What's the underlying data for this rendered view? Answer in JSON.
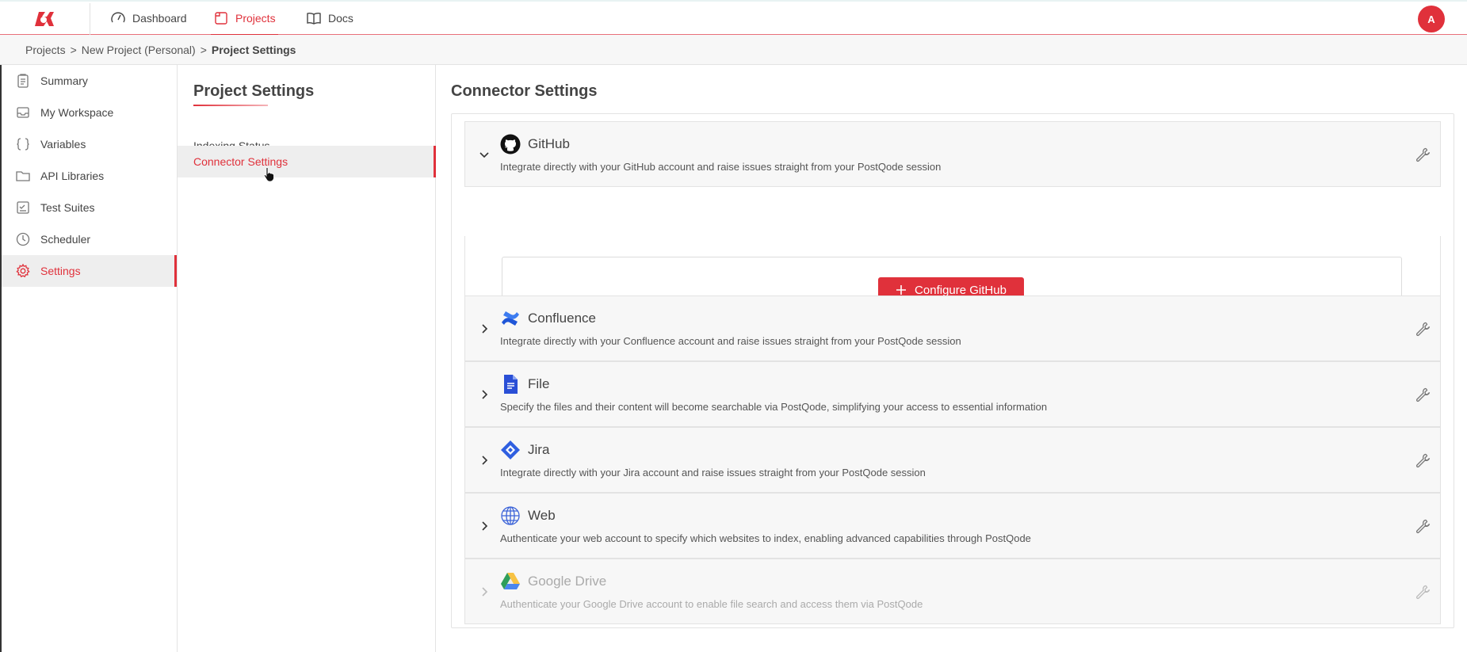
{
  "nav": {
    "tabs": [
      {
        "label": "Dashboard",
        "icon": "gauge-icon"
      },
      {
        "label": "Projects",
        "icon": "folder-icon"
      },
      {
        "label": "Docs",
        "icon": "book-icon"
      }
    ],
    "active_tab": "Projects",
    "avatar_initial": "A",
    "accent_color": "#e0313b"
  },
  "breadcrumb": {
    "items": [
      "Projects",
      "New Project (Personal)",
      "Project Settings"
    ],
    "separator": ">"
  },
  "sidebar": {
    "items": [
      {
        "label": "Summary",
        "icon": "clipboard-icon"
      },
      {
        "label": "My Workspace",
        "icon": "inbox-icon"
      },
      {
        "label": "Variables",
        "icon": "braces-icon"
      },
      {
        "label": "API Libraries",
        "icon": "folder-icon"
      },
      {
        "label": "Test Suites",
        "icon": "checklist-icon"
      },
      {
        "label": "Scheduler",
        "icon": "clock-icon"
      },
      {
        "label": "Settings",
        "icon": "gear-icon"
      }
    ],
    "active": "Settings"
  },
  "settings": {
    "title": "Project Settings",
    "items": [
      "Indexing Status",
      "Connector Settings"
    ],
    "active": "Connector Settings"
  },
  "main": {
    "title": "Connector Settings",
    "connectors": [
      {
        "name": "GitHub",
        "description": "Integrate directly with your GitHub account and raise issues straight from your PostQode session",
        "icon": "github-icon",
        "expanded": true
      },
      {
        "name": "Confluence",
        "description": "Integrate directly with your Confluence account and raise issues straight from your PostQode session",
        "icon": "confluence-icon",
        "expanded": false
      },
      {
        "name": "File",
        "description": "Specify the files and their content will become searchable via PostQode, simplifying your access to essential information",
        "icon": "file-icon",
        "expanded": false
      },
      {
        "name": "Jira",
        "description": "Integrate directly with your Jira account and raise issues straight from your PostQode session",
        "icon": "jira-icon",
        "expanded": false
      },
      {
        "name": "Web",
        "description": "Authenticate your web account to specify which websites to index, enabling advanced capabilities through PostQode",
        "icon": "globe-icon",
        "expanded": false
      },
      {
        "name": "Google Drive",
        "description": "Authenticate your Google Drive account to enable file search and access them via PostQode",
        "icon": "google-drive-icon",
        "expanded": false,
        "disabled": true
      }
    ],
    "configure_button": "Configure GitHub"
  }
}
